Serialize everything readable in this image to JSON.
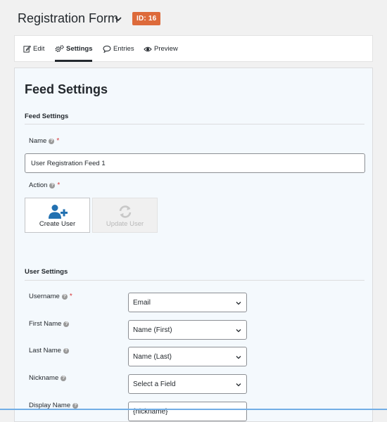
{
  "header": {
    "form_title": "Registration Form",
    "id_badge": "ID: 16"
  },
  "tabs": [
    {
      "label": "Edit",
      "icon": "edit-icon"
    },
    {
      "label": "Settings",
      "icon": "gears-icon",
      "active": true
    },
    {
      "label": "Entries",
      "icon": "speech-bubble-icon"
    },
    {
      "label": "Preview",
      "icon": "eye-icon"
    }
  ],
  "page": {
    "title": "Feed Settings",
    "feed_section": "Feed Settings",
    "name_label": "Name",
    "name_value": "User Registration Feed 1",
    "action_label": "Action",
    "actions": [
      {
        "label": "Create User",
        "icon": "add-user-icon",
        "selected": true
      },
      {
        "label": "Update User",
        "icon": "refresh-icon",
        "disabled": true
      }
    ],
    "user_section": "User Settings",
    "fields": [
      {
        "label": "Username",
        "required": true,
        "value": "Email"
      },
      {
        "label": "First Name",
        "value": "Name (First)"
      },
      {
        "label": "Last Name",
        "value": "Name (Last)"
      },
      {
        "label": "Nickname",
        "value": "Select a Field"
      },
      {
        "label": "Display Name",
        "value": "{nickname}"
      }
    ],
    "required_mark": "*",
    "help_glyph": "?"
  },
  "colors": {
    "badge": "#dd6a3b",
    "required": "#d63638",
    "panel_bg": "#f4f9fd",
    "accent_line": "#72aee6"
  }
}
